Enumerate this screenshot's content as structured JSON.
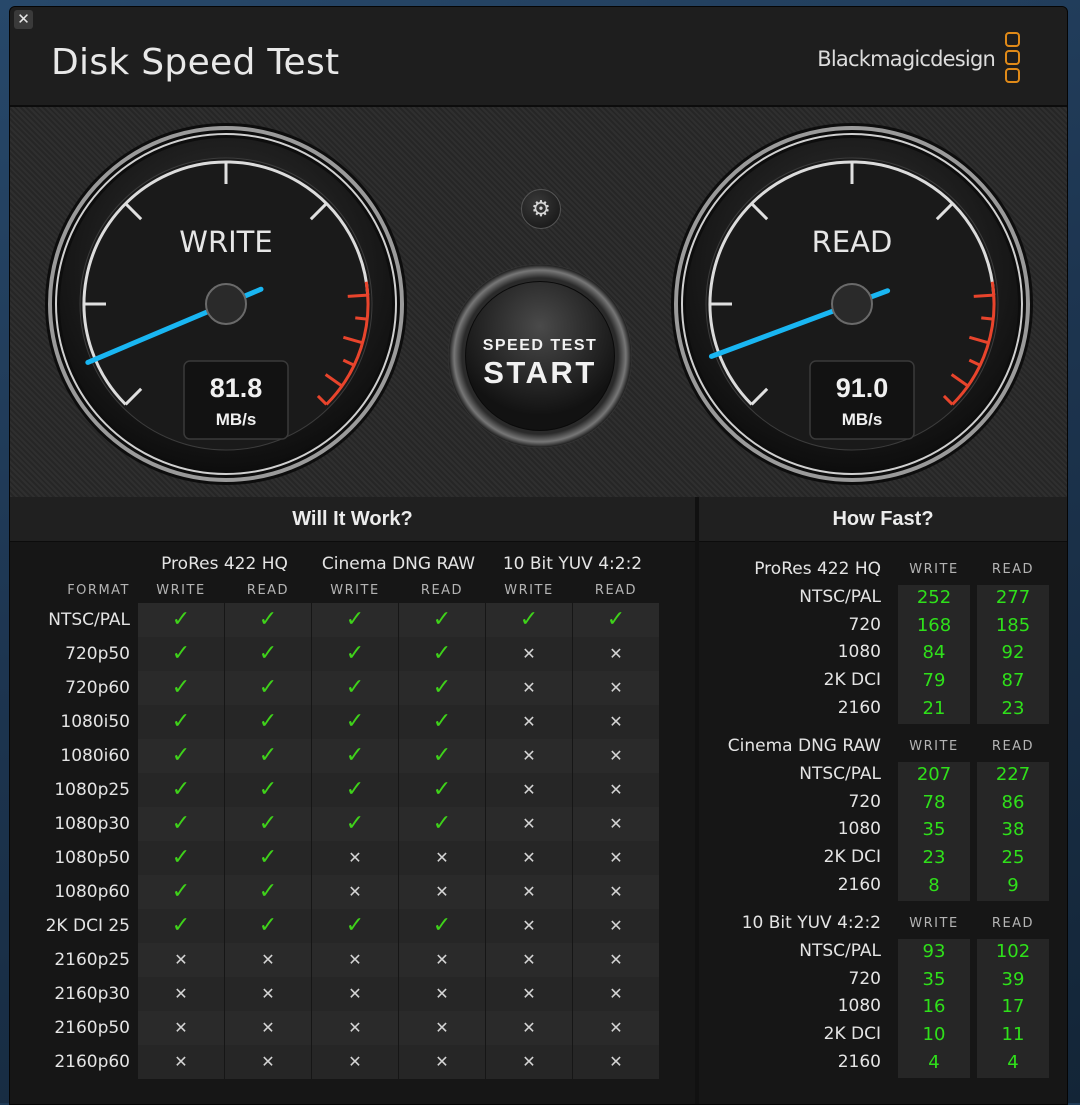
{
  "app": {
    "title": "Disk Speed Test",
    "brand": "Blackmagicdesign",
    "close_glyph": "✕",
    "settings_icon": "gear-icon"
  },
  "write_gauge": {
    "label": "WRITE",
    "value": "81.8",
    "unit": "MB/s",
    "needle_value": 81.8
  },
  "read_gauge": {
    "label": "READ",
    "value": "91.0",
    "unit": "MB/s",
    "needle_value": 91.0
  },
  "start_button": {
    "line1": "SPEED TEST",
    "line2": "START"
  },
  "colors": {
    "accent_needle": "#19b6f2",
    "redline": "#e8442c",
    "ok": "#3fd21a",
    "speed_values": "#2fe01a",
    "brand_logo": "#e08a18"
  },
  "will_it_work": {
    "title": "Will It Work?",
    "format_label": "FORMAT",
    "groups": [
      "ProRes 422 HQ",
      "Cinema DNG RAW",
      "10 Bit YUV 4:2:2"
    ],
    "subcols": [
      "WRITE",
      "READ",
      "WRITE",
      "READ",
      "WRITE",
      "READ"
    ],
    "rows": [
      {
        "format": "NTSC/PAL",
        "results": [
          1,
          1,
          1,
          1,
          1,
          1
        ]
      },
      {
        "format": "720p50",
        "results": [
          1,
          1,
          1,
          1,
          0,
          0
        ]
      },
      {
        "format": "720p60",
        "results": [
          1,
          1,
          1,
          1,
          0,
          0
        ]
      },
      {
        "format": "1080i50",
        "results": [
          1,
          1,
          1,
          1,
          0,
          0
        ]
      },
      {
        "format": "1080i60",
        "results": [
          1,
          1,
          1,
          1,
          0,
          0
        ]
      },
      {
        "format": "1080p25",
        "results": [
          1,
          1,
          1,
          1,
          0,
          0
        ]
      },
      {
        "format": "1080p30",
        "results": [
          1,
          1,
          1,
          1,
          0,
          0
        ]
      },
      {
        "format": "1080p50",
        "results": [
          1,
          1,
          0,
          0,
          0,
          0
        ]
      },
      {
        "format": "1080p60",
        "results": [
          1,
          1,
          0,
          0,
          0,
          0
        ]
      },
      {
        "format": "2K DCI 25",
        "results": [
          1,
          1,
          1,
          1,
          0,
          0
        ]
      },
      {
        "format": "2160p25",
        "results": [
          0,
          0,
          0,
          0,
          0,
          0
        ]
      },
      {
        "format": "2160p30",
        "results": [
          0,
          0,
          0,
          0,
          0,
          0
        ]
      },
      {
        "format": "2160p50",
        "results": [
          0,
          0,
          0,
          0,
          0,
          0
        ]
      },
      {
        "format": "2160p60",
        "results": [
          0,
          0,
          0,
          0,
          0,
          0
        ]
      }
    ]
  },
  "how_fast": {
    "title": "How Fast?",
    "write_label": "WRITE",
    "read_label": "READ",
    "sections": [
      {
        "name": "ProRes 422 HQ",
        "rows": [
          {
            "format": "NTSC/PAL",
            "write": "252",
            "read": "277"
          },
          {
            "format": "720",
            "write": "168",
            "read": "185"
          },
          {
            "format": "1080",
            "write": "84",
            "read": "92"
          },
          {
            "format": "2K DCI",
            "write": "79",
            "read": "87"
          },
          {
            "format": "2160",
            "write": "21",
            "read": "23"
          }
        ]
      },
      {
        "name": "Cinema DNG RAW",
        "rows": [
          {
            "format": "NTSC/PAL",
            "write": "207",
            "read": "227"
          },
          {
            "format": "720",
            "write": "78",
            "read": "86"
          },
          {
            "format": "1080",
            "write": "35",
            "read": "38"
          },
          {
            "format": "2K DCI",
            "write": "23",
            "read": "25"
          },
          {
            "format": "2160",
            "write": "8",
            "read": "9"
          }
        ]
      },
      {
        "name": "10 Bit YUV 4:2:2",
        "rows": [
          {
            "format": "NTSC/PAL",
            "write": "93",
            "read": "102"
          },
          {
            "format": "720",
            "write": "35",
            "read": "39"
          },
          {
            "format": "1080",
            "write": "16",
            "read": "17"
          },
          {
            "format": "2K DCI",
            "write": "10",
            "read": "11"
          },
          {
            "format": "2160",
            "write": "4",
            "read": "4"
          }
        ]
      }
    ]
  }
}
